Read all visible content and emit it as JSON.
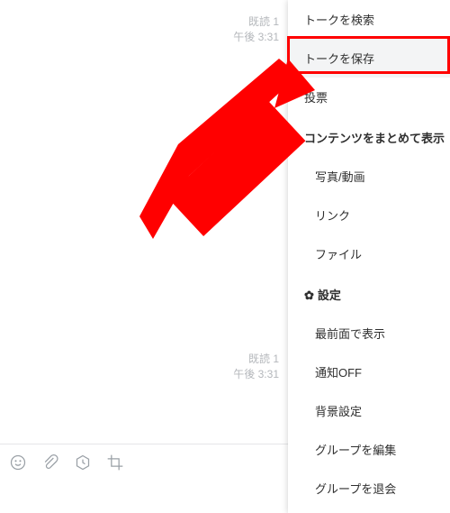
{
  "chat": {
    "status1_read": "既読 1",
    "status1_time": "午後 3:31",
    "status2_read": "既読 1",
    "status2_time": "午後 3:31"
  },
  "menu": {
    "search_talk": "トークを検索",
    "save_talk": "トークを保存",
    "poll": "投票",
    "contents_heading": "コンテンツをまとめて表示",
    "photo_video": "写真/動画",
    "link": "リンク",
    "file": "ファイル",
    "settings_heading": "設定",
    "always_top": "最前面で表示",
    "notify_off": "通知OFF",
    "bg_setting": "背景設定",
    "edit_group": "グループを編集",
    "leave_group": "グループを退会"
  },
  "icons": {
    "gear": "✿"
  }
}
